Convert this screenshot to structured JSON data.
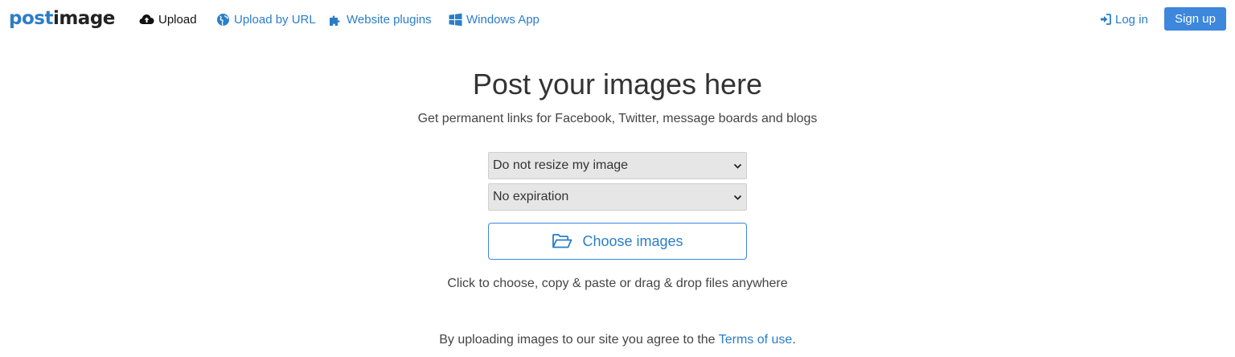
{
  "logo": {
    "part1": "post",
    "part2": "image"
  },
  "nav": {
    "upload": "Upload",
    "upload_by_url": "Upload by URL",
    "website_plugins": "Website plugins",
    "windows_app": "Windows App",
    "login": "Log in",
    "signup": "Sign up"
  },
  "hero": {
    "title": "Post your images here",
    "subtitle": "Get permanent links for Facebook, Twitter, message boards and blogs"
  },
  "form": {
    "resize_value": "Do not resize my image",
    "expiration_value": "No expiration",
    "choose_label": "Choose images",
    "hint": "Click to choose, copy & paste or drag & drop files anywhere"
  },
  "footer": {
    "terms_prefix": "By uploading images to our site you agree to the ",
    "terms_link": "Terms of use",
    "terms_suffix": "."
  },
  "colors": {
    "accent": "#2a7ec8",
    "signup_bg": "#3d87dc",
    "select_bg": "#e6e6e6"
  },
  "icons": {
    "upload": "cloud-upload-icon",
    "url": "globe-icon",
    "plugins": "puzzle-icon",
    "windows": "windows-icon",
    "login": "sign-in-icon",
    "choose": "folder-open-icon",
    "chevron": "chevron-down-icon"
  }
}
